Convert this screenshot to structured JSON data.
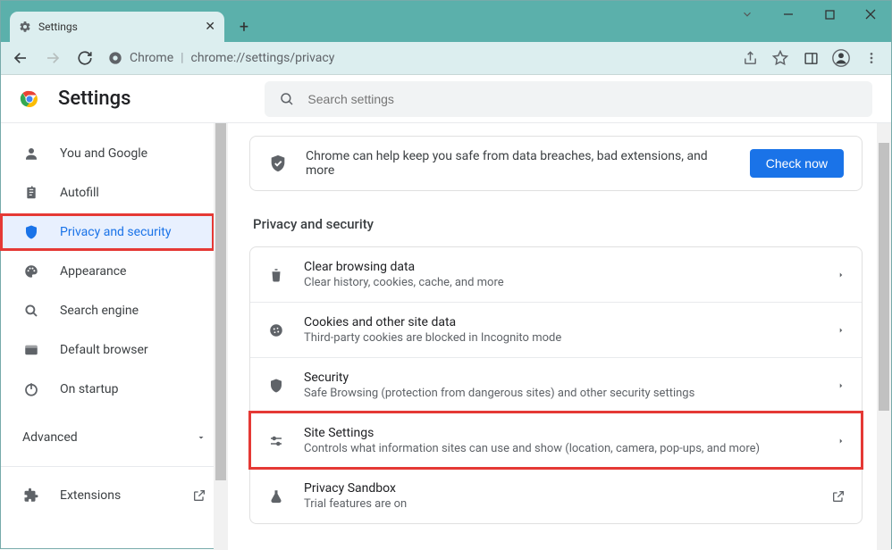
{
  "window": {
    "tab_title": "Settings",
    "url_prefix": "Chrome",
    "url": "chrome://settings/privacy"
  },
  "header": {
    "title": "Settings",
    "search_placeholder": "Search settings"
  },
  "sidebar": {
    "items": [
      {
        "label": "You and Google"
      },
      {
        "label": "Autofill"
      },
      {
        "label": "Privacy and security"
      },
      {
        "label": "Appearance"
      },
      {
        "label": "Search engine"
      },
      {
        "label": "Default browser"
      },
      {
        "label": "On startup"
      }
    ],
    "advanced": "Advanced",
    "extensions": "Extensions"
  },
  "main": {
    "safety_msg": "Chrome can help keep you safe from data breaches, bad extensions, and more",
    "check_now": "Check now",
    "section_title": "Privacy and security",
    "rows": [
      {
        "title": "Clear browsing data",
        "sub": "Clear history, cookies, cache, and more"
      },
      {
        "title": "Cookies and other site data",
        "sub": "Third-party cookies are blocked in Incognito mode"
      },
      {
        "title": "Security",
        "sub": "Safe Browsing (protection from dangerous sites) and other security settings"
      },
      {
        "title": "Site Settings",
        "sub": "Controls what information sites can use and show (location, camera, pop-ups, and more)"
      },
      {
        "title": "Privacy Sandbox",
        "sub": "Trial features are on"
      }
    ]
  }
}
